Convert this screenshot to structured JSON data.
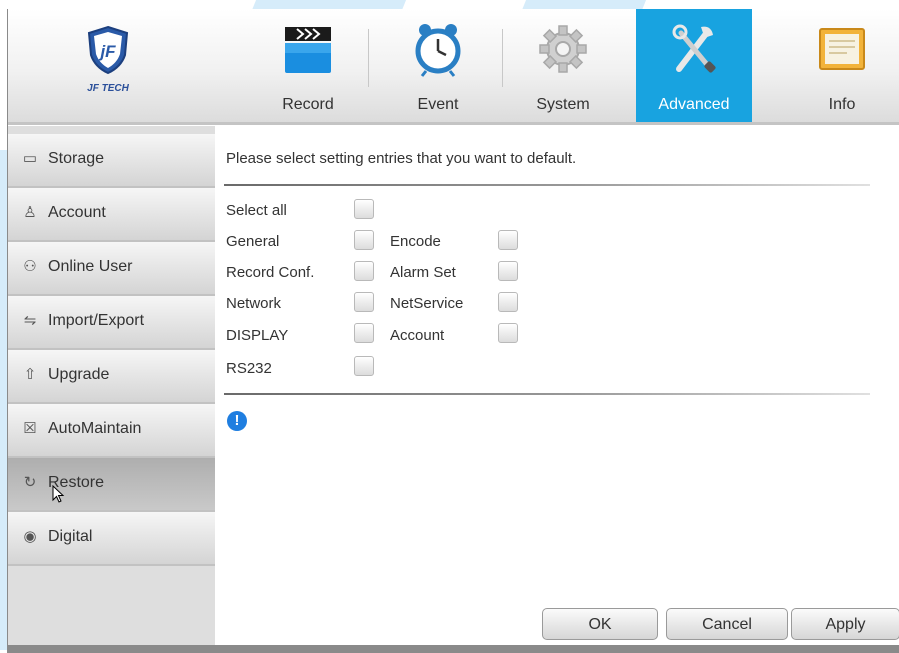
{
  "logo": {
    "text": "JF TECH"
  },
  "tabs": [
    {
      "label": "Record",
      "icon": "clapperboard-icon"
    },
    {
      "label": "Event",
      "icon": "alarm-clock-icon"
    },
    {
      "label": "System",
      "icon": "gear-icon"
    },
    {
      "label": "Advanced",
      "icon": "tools-icon",
      "active": true
    },
    {
      "label": "Info",
      "icon": "monitor-icon"
    }
  ],
  "sidebar": {
    "items": [
      {
        "label": "Storage",
        "icon": "storage-icon"
      },
      {
        "label": "Account",
        "icon": "user-icon"
      },
      {
        "label": "Online User",
        "icon": "users-icon"
      },
      {
        "label": "Import/Export",
        "icon": "import-export-icon"
      },
      {
        "label": "Upgrade",
        "icon": "upgrade-icon"
      },
      {
        "label": "AutoMaintain",
        "icon": "calendar-icon"
      },
      {
        "label": "Restore",
        "icon": "restore-icon",
        "selected": true
      },
      {
        "label": "Digital",
        "icon": "digital-icon"
      }
    ]
  },
  "main": {
    "headline": "Please select setting entries that you want to default.",
    "select_all": "Select all",
    "options_left": [
      "General",
      "Record Conf.",
      "Network",
      "DISPLAY",
      "RS232"
    ],
    "options_right": [
      "Encode",
      "Alarm Set",
      "NetService",
      "Account"
    ]
  },
  "buttons": {
    "ok": "OK",
    "cancel": "Cancel",
    "apply": "Apply"
  },
  "colors": {
    "accent": "#18a3e0",
    "info": "#1f7ee0"
  }
}
